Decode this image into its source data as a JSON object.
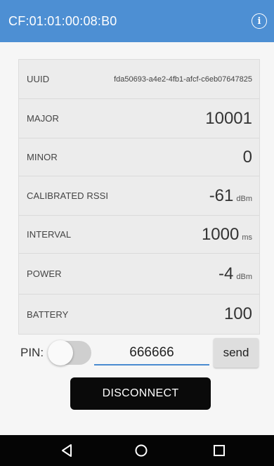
{
  "appbar": {
    "title": "CF:01:01:00:08:B0",
    "info_icon": "info-icon"
  },
  "beacon": {
    "rows": [
      {
        "label": "UUID",
        "value": "fda50693-a4e2-4fb1-afcf-c6eb07647825",
        "unit": ""
      },
      {
        "label": "MAJOR",
        "value": "10001",
        "unit": ""
      },
      {
        "label": "MINOR",
        "value": "0",
        "unit": ""
      },
      {
        "label": "CALIBRATED RSSI",
        "value": "-61",
        "unit": "dBm"
      },
      {
        "label": "INTERVAL",
        "value": "1000",
        "unit": "ms"
      },
      {
        "label": "POWER",
        "value": "-4",
        "unit": "dBm"
      },
      {
        "label": "BATTERY",
        "value": "100",
        "unit": ""
      }
    ]
  },
  "pin": {
    "label": "PIN:",
    "toggle_on": false,
    "value": "666666",
    "send_label": "send"
  },
  "disconnect_label": "DISCONNECT",
  "navbar": {
    "back_icon": "triangle-back-icon",
    "home_icon": "circle-home-icon",
    "recent_icon": "square-recents-icon"
  },
  "colors": {
    "appbar": "#4d8fd3",
    "card": "#ececec",
    "accent": "#4a8bd0",
    "disconnect": "#0a0a0a",
    "navbar": "#050505"
  }
}
